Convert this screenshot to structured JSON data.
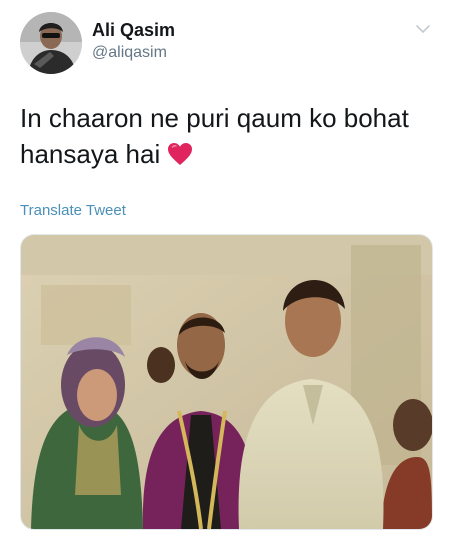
{
  "author": {
    "display_name": "Ali Qasim",
    "handle": "@aliqasim",
    "avatar_icon": "user-avatar-photo"
  },
  "menu": {
    "icon": "chevron-down-icon"
  },
  "tweet": {
    "text_line1": "In chaaron ne puri qaum ko bohat",
    "text_line2": "hansaya hai",
    "emoji": "red-heart-emoji"
  },
  "actions": {
    "translate_label": "Translate Tweet"
  },
  "media": {
    "type": "photo"
  },
  "colors": {
    "link": "#4a90b8",
    "secondary_text": "#657786",
    "heart": "#e0245e"
  }
}
